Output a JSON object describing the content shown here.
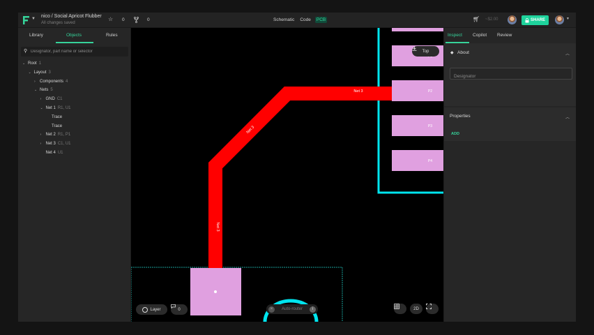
{
  "header": {
    "project_title": "nico / Social Apricot Flubber",
    "project_subtitle": "All changes saved",
    "star_count": "0",
    "fork_count": "0",
    "view_tabs": [
      "Schematic",
      "Code",
      "PCB"
    ],
    "active_view": "PCB",
    "price": "~$2.00",
    "share_label": "SHARE"
  },
  "left_panel": {
    "tabs": [
      "Library",
      "Objects",
      "Rules"
    ],
    "active_tab": "Objects",
    "search_placeholder": "Designator, part name or selector",
    "tree": [
      {
        "label": "Root",
        "count": "1",
        "depth": 0,
        "expanded": true
      },
      {
        "label": "Layout",
        "count": "3",
        "depth": 1,
        "expanded": true
      },
      {
        "label": "Components",
        "count": "4",
        "depth": 2,
        "expanded": false
      },
      {
        "label": "Nets",
        "count": "5",
        "depth": 2,
        "expanded": true
      },
      {
        "label": "GND",
        "count": "C1",
        "depth": 3,
        "expanded": false
      },
      {
        "label": "Net 1",
        "count": "R1, U1",
        "depth": 3,
        "expanded": true
      },
      {
        "label": "Trace",
        "count": "",
        "depth": 4,
        "expanded": null
      },
      {
        "label": "Trace",
        "count": "",
        "depth": 4,
        "expanded": null
      },
      {
        "label": "Net 2",
        "count": "R1, P1",
        "depth": 3,
        "expanded": false
      },
      {
        "label": "Net 3",
        "count": "C1, U1",
        "depth": 3,
        "expanded": false
      },
      {
        "label": "Net 4",
        "count": "U1",
        "depth": 3,
        "expanded": null
      }
    ]
  },
  "canvas": {
    "layer_toggle_label": "Top",
    "trace_labels": [
      "Net 3",
      "Net 3",
      "Net 3"
    ],
    "pad_labels": [
      "P1",
      "P2",
      "P3",
      "P4"
    ],
    "layer_button_label": "Layer",
    "comments_count": "0",
    "autoroute_label": "Auto-router",
    "view_mode_label": "2D",
    "colors": {
      "trace": "#ff0000",
      "pad": "#e0a0e0",
      "outline": "#00e5ee",
      "board_edge": "#1aa19a"
    }
  },
  "right_panel": {
    "tabs": [
      "Inspect",
      "Copilot",
      "Review"
    ],
    "active_tab": "Inspect",
    "about_title": "About",
    "designator_placeholder": "Designator",
    "properties_title": "Properties",
    "add_label": "ADD"
  },
  "colors": {
    "accent": "#36d39a",
    "background": "#232323"
  }
}
